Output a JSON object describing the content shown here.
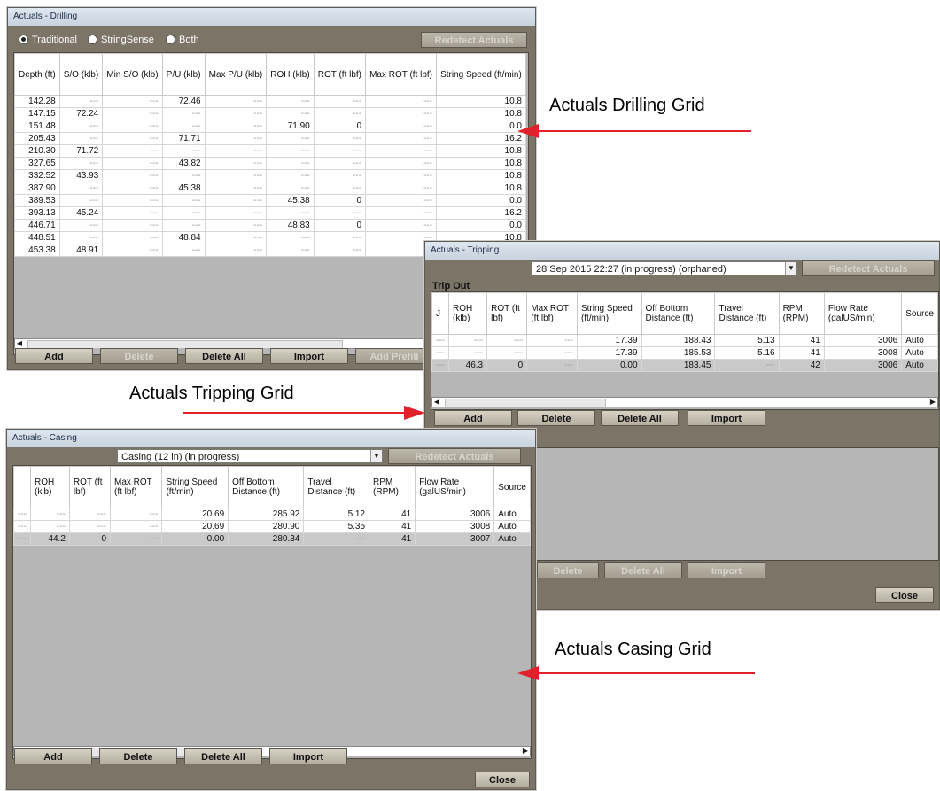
{
  "drilling": {
    "title": "Actuals - Drilling",
    "radios": [
      "Traditional",
      "StringSense",
      "Both"
    ],
    "redetect_label": "Redetect Actuals",
    "columns": [
      "Depth (ft)",
      "S/O (klb)",
      "Min S/O (klb)",
      "P/U (klb)",
      "Max P/U (klb)",
      "ROH (klb)",
      "ROT (ft lbf)",
      "Max ROT (ft lbf)",
      "String Speed (ft/min)"
    ],
    "rows": [
      [
        "142.28",
        "---",
        "---",
        "72.46",
        "---",
        "---",
        "---",
        "---",
        "10.8"
      ],
      [
        "147.15",
        "72.24",
        "---",
        "---",
        "---",
        "---",
        "---",
        "---",
        "10.8"
      ],
      [
        "151.48",
        "---",
        "---",
        "---",
        "---",
        "71.90",
        "0",
        "---",
        "0.0"
      ],
      [
        "205.43",
        "---",
        "---",
        "71.71",
        "---",
        "---",
        "---",
        "---",
        "16.2"
      ],
      [
        "210.30",
        "71.72",
        "---",
        "---",
        "---",
        "---",
        "---",
        "---",
        "10.8"
      ],
      [
        "327.65",
        "---",
        "---",
        "43.82",
        "---",
        "---",
        "---",
        "---",
        "10.8"
      ],
      [
        "332.52",
        "43.93",
        "---",
        "---",
        "---",
        "---",
        "---",
        "---",
        "10.8"
      ],
      [
        "387.90",
        "---",
        "---",
        "45.38",
        "---",
        "---",
        "---",
        "---",
        "10.8"
      ],
      [
        "389.53",
        "---",
        "---",
        "---",
        "---",
        "45.38",
        "0",
        "---",
        "0.0"
      ],
      [
        "393.13",
        "45.24",
        "---",
        "---",
        "---",
        "---",
        "---",
        "---",
        "16.2"
      ],
      [
        "446.71",
        "---",
        "---",
        "---",
        "---",
        "48.83",
        "0",
        "---",
        "0.0"
      ],
      [
        "448.51",
        "---",
        "---",
        "48.84",
        "---",
        "---",
        "---",
        "---",
        "10.8"
      ],
      [
        "453.38",
        "48.91",
        "---",
        "---",
        "---",
        "---",
        "---",
        "---",
        ""
      ]
    ],
    "buttons": [
      "Add",
      "Delete",
      "Delete All",
      "Import",
      "Add Prefill"
    ]
  },
  "tripping": {
    "title": "Actuals - Tripping",
    "combo_value": "28 Sep 2015 22:27 (in progress) (orphaned)",
    "redetect_label": "Redetect Actuals",
    "section_label": "Trip Out",
    "columns": [
      "J",
      "ROH (klb)",
      "ROT (ft lbf)",
      "Max ROT (ft lbf)",
      "String Speed (ft/min)",
      "Off Bottom Distance (ft)",
      "Travel Distance (ft)",
      "RPM (RPM)",
      "Flow Rate (galUS/min)",
      "Source"
    ],
    "rows": [
      [
        "---",
        "---",
        "---",
        "---",
        "17.39",
        "188.43",
        "5.13",
        "41",
        "3006",
        "Auto"
      ],
      [
        "---",
        "---",
        "---",
        "---",
        "17.39",
        "185.53",
        "5.16",
        "41",
        "3008",
        "Auto"
      ],
      [
        "---",
        "46.3",
        "0",
        "---",
        "0.00",
        "183.45",
        "---",
        "42",
        "3006",
        "Auto"
      ]
    ],
    "buttons": [
      "Add",
      "Delete",
      "Delete All",
      "Import"
    ],
    "lower_buttons": [
      "Delete",
      "Delete All",
      "Import"
    ],
    "close_label": "Close"
  },
  "casing": {
    "title": "Actuals - Casing",
    "combo_value": "Casing (12 in) (in progress)",
    "redetect_label": "Redetect Actuals",
    "columns": [
      "",
      "ROH (klb)",
      "ROT (ft lbf)",
      "Max ROT (ft lbf)",
      "String Speed (ft/min)",
      "Off Bottom Distance (ft)",
      "Travel Distance (ft)",
      "RPM (RPM)",
      "Flow Rate (galUS/min)",
      "Source"
    ],
    "rows": [
      [
        "---",
        "---",
        "---",
        "---",
        "20.69",
        "285.92",
        "5.12",
        "41",
        "3006",
        "Auto"
      ],
      [
        "---",
        "---",
        "---",
        "---",
        "20.69",
        "280.90",
        "5.35",
        "41",
        "3008",
        "Auto"
      ],
      [
        "---",
        "44.2",
        "0",
        "---",
        "0.00",
        "280.34",
        "---",
        "41",
        "3007",
        "Auto"
      ]
    ],
    "buttons": [
      "Add",
      "Delete",
      "Delete All",
      "Import"
    ],
    "close_label": "Close"
  },
  "callouts": {
    "drilling": "Actuals Drilling Grid",
    "tripping": "Actuals Tripping Grid",
    "casing": "Actuals Casing Grid"
  },
  "colors": {
    "arrow": "#e0202a",
    "dialog_bg": "#7b7467",
    "grid_bg": "#b6b6b6"
  }
}
